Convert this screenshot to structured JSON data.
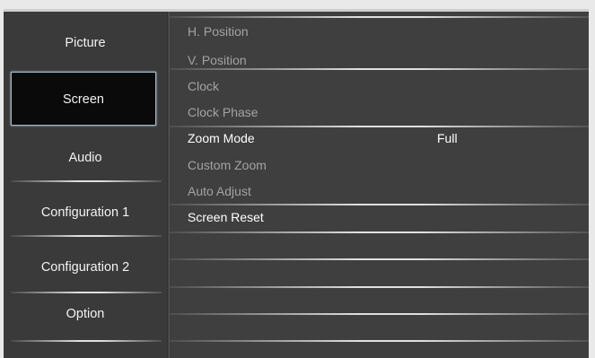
{
  "menu": [
    {
      "label": "Picture",
      "selected": false
    },
    {
      "label": "Screen",
      "selected": true
    },
    {
      "label": "Audio",
      "selected": false
    },
    {
      "label": "Configuration 1",
      "selected": false
    },
    {
      "label": "Configuration 2",
      "selected": false
    },
    {
      "label": "Option",
      "selected": false
    }
  ],
  "screen_settings": [
    {
      "label": "H. Position",
      "value": "",
      "enabled": false
    },
    {
      "label": "V. Position",
      "value": "",
      "enabled": false
    },
    {
      "label": "Clock",
      "value": "",
      "enabled": false
    },
    {
      "label": "Clock Phase",
      "value": "",
      "enabled": false
    },
    {
      "label": "Zoom Mode",
      "value": "Full",
      "enabled": true
    },
    {
      "label": "Custom Zoom",
      "value": "",
      "enabled": false
    },
    {
      "label": "Auto Adjust",
      "value": "",
      "enabled": false
    },
    {
      "label": "Screen Reset",
      "value": "",
      "enabled": true
    }
  ],
  "colors": {
    "panel_bg": "#404040",
    "selected_bg": "#0a0a0a",
    "selected_border": "#9fb6c8",
    "enabled_text": "#ffffff",
    "disabled_text": "#a3a3a3"
  }
}
